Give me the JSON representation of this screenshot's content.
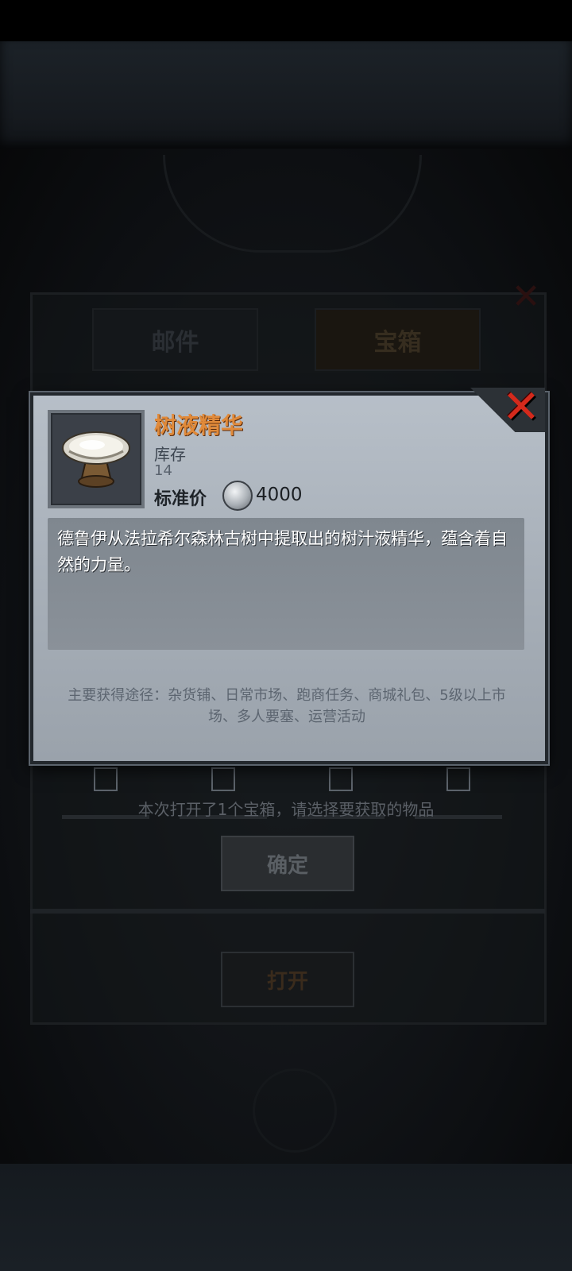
{
  "background": {
    "tabs": [
      "邮件",
      "宝箱"
    ],
    "hint": "本次打开了1个宝箱，请选择要获取的物品",
    "confirm_label": "确定",
    "open_label": "打开"
  },
  "item": {
    "name": "树液精华",
    "stock_label": "库存",
    "stock_value": "14",
    "price_label": "标准价",
    "price_value": "4000",
    "description": "德鲁伊从法拉希尔森林古树中提取出的树汁液精华，蕴含着自然的力量。",
    "source": "主要获得途径：杂货铺、日常市场、跑商任务、商城礼包、5级以上市场、多人要塞、运营活动"
  },
  "colors": {
    "item_name": "#e08a3a",
    "close_icon": "#d42a1c",
    "dialog_bg": "#aab2bb"
  },
  "icons": {
    "close": "close-icon",
    "item": "sap-essence-bowl-icon",
    "currency": "silver-coin-icon"
  }
}
